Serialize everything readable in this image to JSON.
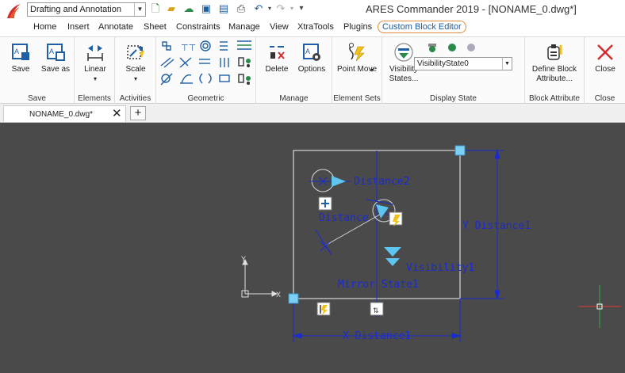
{
  "app": {
    "workspace": "Drafting and Annotation",
    "title": "ARES Commander 2019 - [NONAME_0.dwg*]"
  },
  "quick_access": [
    "new-icon",
    "open-icon",
    "cloud-icon",
    "save-icon",
    "save-as-icon",
    "print-icon",
    "undo-icon",
    "redo-icon",
    "customize-icon"
  ],
  "tabs": [
    "Home",
    "Insert",
    "Annotate",
    "Sheet",
    "Constraints",
    "Manage",
    "View",
    "XtraTools",
    "Plugins",
    "Custom Block Editor"
  ],
  "active_tab": "Custom Block Editor",
  "ribbon": {
    "groups": {
      "save": "Save",
      "elements": "Elements",
      "activities": "Activities",
      "geometric": "Geometric",
      "manage": "Manage",
      "element_sets": "Element Sets",
      "display_state": "Display State",
      "block_attribute": "Block Attribute",
      "close": "Close"
    },
    "buttons": {
      "save": "Save",
      "save_as": "Save as",
      "linear": "Linear",
      "scale": "Scale",
      "delete": "Delete",
      "options": "Options",
      "point_move": "Point Move",
      "visibility_states": "Visibility States...",
      "define_block_attribute": "Define Block Attribute...",
      "close": "Close"
    },
    "visibility_state_value": "VisibilityState0"
  },
  "document_tab": {
    "label": "NONAME_0.dwg*",
    "close": "✕",
    "new": "+"
  },
  "drawing": {
    "labels": {
      "distance2": "Distance2",
      "distance": "Distance",
      "y_distance1": "Y Distance1",
      "visibility1": "Visibility1",
      "mirror_state1": "Mirror State1",
      "x_distance1": "X Distance1"
    },
    "ucs": {
      "x": "X",
      "y": "Y"
    }
  }
}
